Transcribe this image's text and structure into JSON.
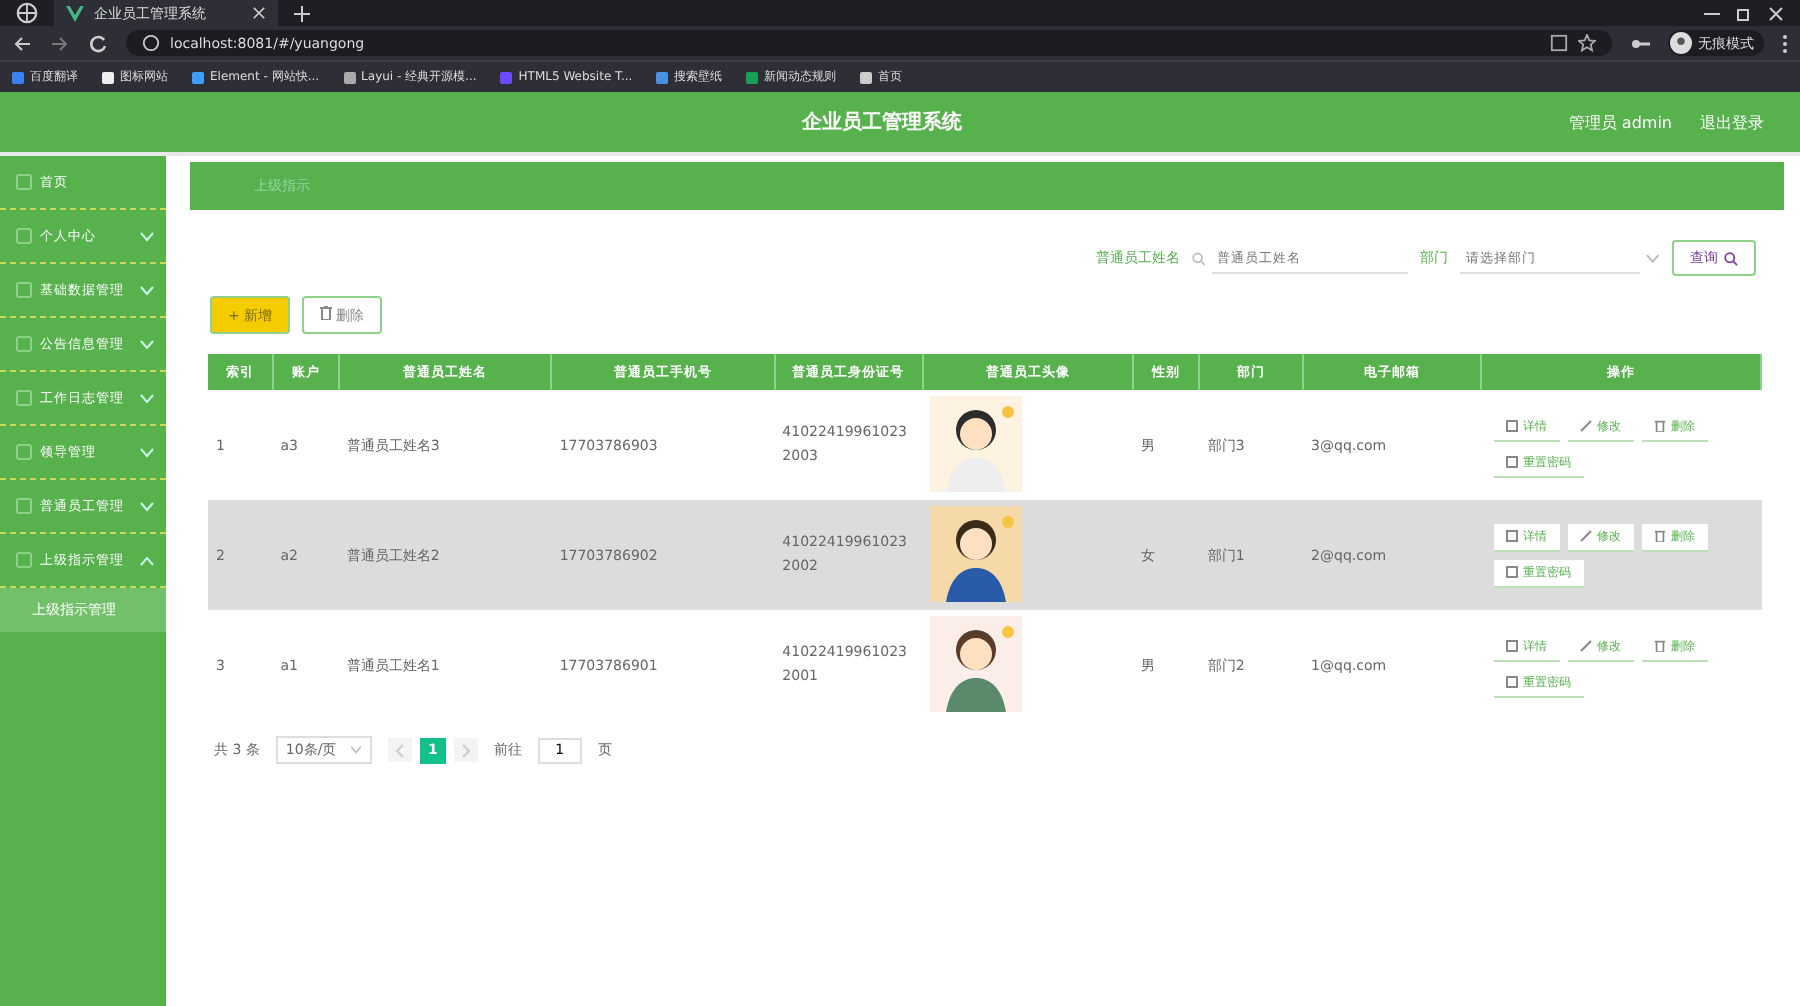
{
  "browser": {
    "tab_title": "企业员工管理系统",
    "url": "localhost:8081/#/yuangong",
    "profile": "无痕模式",
    "bookmarks": [
      "百度翻译",
      "图标网站",
      "Element - 网站快...",
      "Layui - 经典开源模...",
      "HTML5 Website T...",
      "搜索壁纸",
      "新闻动态规则",
      "首页"
    ]
  },
  "header": {
    "title": "企业员工管理系统",
    "user": "管理员 admin",
    "logout": "退出登录"
  },
  "sidebar": {
    "items": [
      {
        "label": "首页"
      },
      {
        "label": "个人中心",
        "expanded": false
      },
      {
        "label": "基础数据管理",
        "expanded": false
      },
      {
        "label": "公告信息管理",
        "expanded": false
      },
      {
        "label": "工作日志管理",
        "expanded": false
      },
      {
        "label": "领导管理",
        "expanded": false
      },
      {
        "label": "普通员工管理",
        "expanded": false
      },
      {
        "label": "上级指示管理",
        "expanded": true,
        "children": [
          {
            "label": "上级指示管理",
            "selected": true
          }
        ]
      }
    ]
  },
  "breadcrumb": "上级指示",
  "search": {
    "name_label": "普通员工姓名",
    "name_placeholder": "普通员工姓名",
    "dept_label": "部门",
    "dept_placeholder": "请选择部门",
    "button": "查询"
  },
  "actions": {
    "add": "+ 新增",
    "delete": "删除"
  },
  "table": {
    "columns": [
      "索引",
      "账户",
      "普通员工姓名",
      "普通员工手机号",
      "普通员工身份证号",
      "普通员工头像",
      "性别",
      "部门",
      "电子邮箱",
      "操作"
    ],
    "rows": [
      {
        "index": "1",
        "account": "a3",
        "name": "普通员工姓名3",
        "phone": "17703786903",
        "id_card": "410224199610232003",
        "gender": "男",
        "dept": "部门3",
        "email": "3@qq.com",
        "highlighted": false,
        "buttons": [
          "详情",
          "修改",
          "删除",
          "重置密码"
        ]
      },
      {
        "index": "2",
        "account": "a2",
        "name": "普通员工姓名2",
        "phone": "17703786902",
        "id_card": "410224199610232002",
        "gender": "女",
        "dept": "部门1",
        "email": "2@qq.com",
        "highlighted": true,
        "buttons": [
          "详情",
          "修改",
          "删除",
          "重置密码"
        ]
      },
      {
        "index": "3",
        "account": "a1",
        "name": "普通员工姓名1",
        "phone": "17703786901",
        "id_card": "410224199610232001",
        "gender": "男",
        "dept": "部门2",
        "email": "1@qq.com",
        "highlighted": false,
        "buttons": [
          "详情",
          "修改",
          "删除",
          "重置密码"
        ]
      }
    ]
  },
  "pagination": {
    "total": "共 3 条",
    "page_size": "10条/页",
    "pages": [
      {
        "label": "1",
        "selected": true
      }
    ],
    "goto_label": "前往",
    "goto_value": "1",
    "page_suffix": "页"
  }
}
